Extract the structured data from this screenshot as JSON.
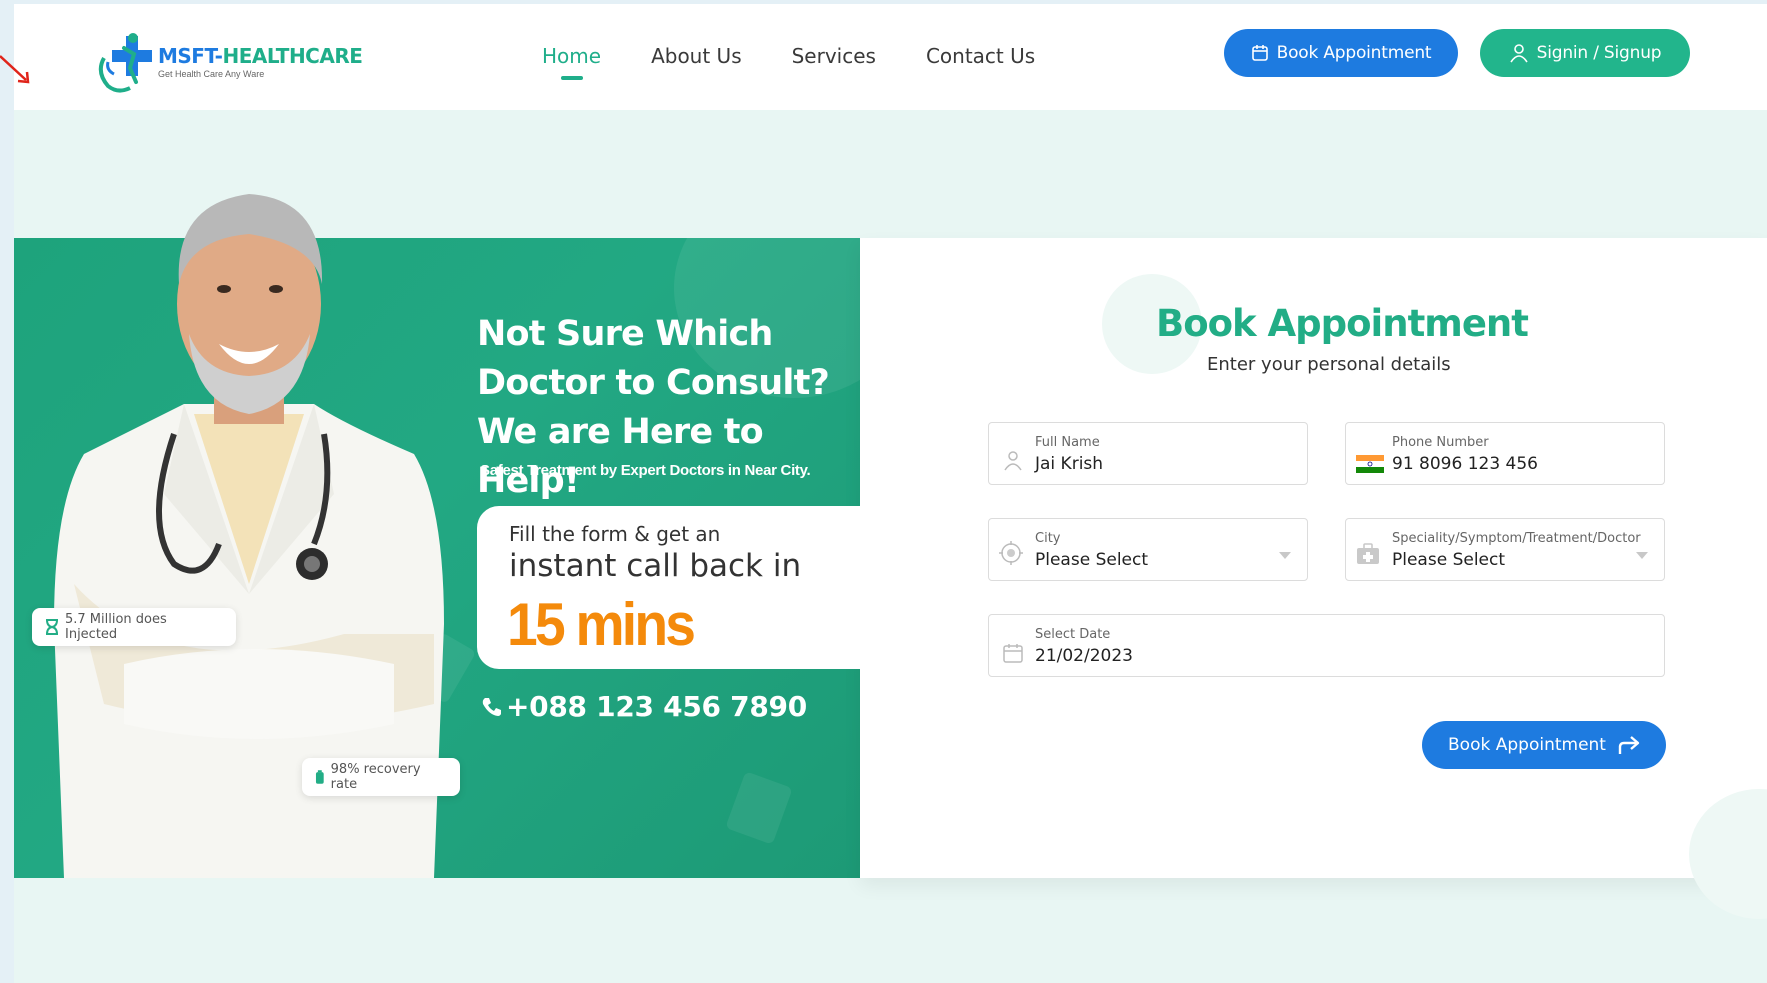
{
  "brand": {
    "name_part1": "MSFT-",
    "name_part2": "HEALTHCARE",
    "tagline": "Get Health Care Any Ware"
  },
  "nav": {
    "items": [
      {
        "label": "Home",
        "active": true
      },
      {
        "label": "About Us",
        "active": false
      },
      {
        "label": "Services",
        "active": false
      },
      {
        "label": "Contact Us",
        "active": false
      }
    ]
  },
  "header_buttons": {
    "book": "Book Appointment",
    "signin": "Signin / Signup"
  },
  "hero": {
    "headline_1": "Not Sure Which",
    "headline_2": "Doctor to Consult?",
    "headline_3": "We are Here to Help!",
    "subhead": "Safest Treatment by Expert Doctors in Near City.",
    "callback_line1": "Fill the form & get an",
    "callback_line2": "instant call back in",
    "callback_time": "15 mins",
    "phone": "+088 123 456 7890",
    "badge_injected": "5.7 Million does Injected",
    "badge_recovery": "98% recovery rate"
  },
  "form": {
    "title": "Book Appointment",
    "subtitle": "Enter your personal details",
    "full_name": {
      "label": "Full Name",
      "value": "Jai Krish"
    },
    "phone": {
      "label": "Phone Number",
      "value": "91 8096 123 456"
    },
    "city": {
      "label": "City",
      "value": "Please Select"
    },
    "speciality": {
      "label": "Speciality/Symptom/Treatment/Doctor",
      "value": "Please Select"
    },
    "date": {
      "label": "Select Date",
      "value": "21/02/2023"
    },
    "submit": "Book Appointment"
  },
  "colors": {
    "primary_blue": "#1e7be0",
    "brand_green": "#1fae8a",
    "accent_orange": "#f48a0b"
  }
}
